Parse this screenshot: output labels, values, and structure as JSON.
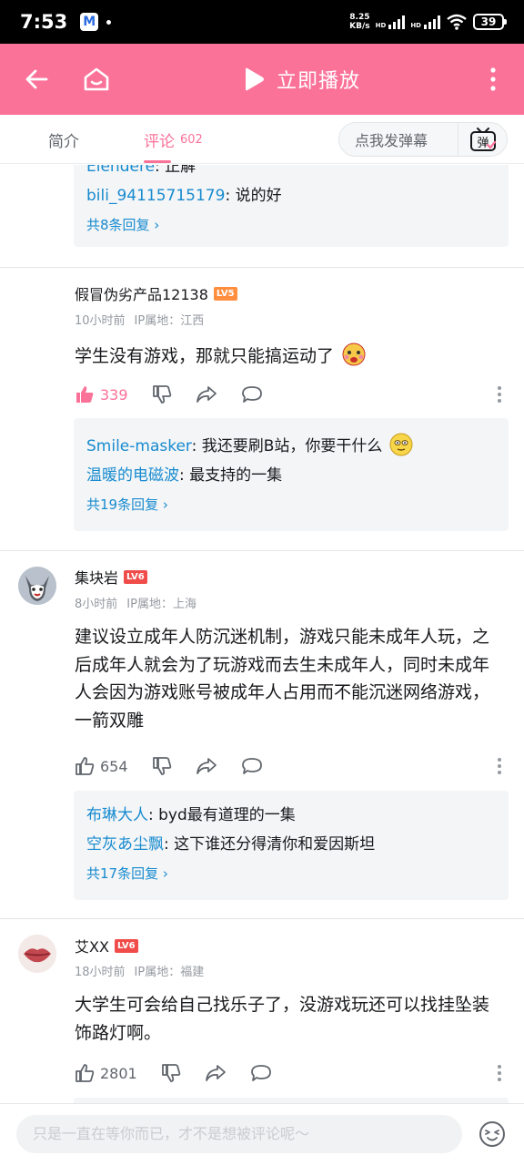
{
  "status_bar": {
    "time": "7:53",
    "app_badge": "M",
    "net_speed_value": "8.25",
    "net_speed_unit": "KB/s",
    "hd_label": "HD",
    "battery": "39"
  },
  "header": {
    "play_label": "立即播放"
  },
  "tabs": {
    "intro_label": "简介",
    "comments_label": "评论",
    "comments_count": "602",
    "danmaku_placeholder": "点我发弹幕",
    "danmaku_button": "弹"
  },
  "top_reply_box": {
    "lines": [
      {
        "user": "Elendere",
        "text": ": 正解"
      },
      {
        "user": "bili_94115715179",
        "text": ": 说的好"
      }
    ],
    "more": "共8条回复 ›"
  },
  "comments": [
    {
      "username": "假冒伪劣产品12138",
      "level": "LV5",
      "time": "10小时前",
      "ip": "IP属地：江西",
      "content": "学生没有游戏，那就只能搞运动了",
      "likes": "339",
      "replies": [
        {
          "user": "Smile-masker",
          "text": ": 我还要刷B站，你要干什么"
        },
        {
          "user": "温暖的电磁波",
          "text": ": 最支持的一集"
        }
      ],
      "more": "共19条回复 ›"
    },
    {
      "username": "集块岩",
      "level": "LV6",
      "time": "8小时前",
      "ip": "IP属地：上海",
      "content": "建议设立成年人防沉迷机制，游戏只能未成年人玩，之后成年人就会为了玩游戏而去生未成年人，同时未成年人会因为游戏账号被成年人占用而不能沉迷网络游戏，一箭双雕",
      "likes": "654",
      "replies": [
        {
          "user": "布琳大人",
          "text": ": byd最有道理的一集"
        },
        {
          "user": "空灰あ尘飘",
          "text": ": 这下谁还分得清你和爱因斯坦"
        }
      ],
      "more": "共17条回复 ›"
    },
    {
      "username": "艾XX",
      "level": "LV6",
      "time": "18小时前",
      "ip": "IP属地：福建",
      "content": "大学生可会给自己找乐子了，没游戏玩还可以找挂坠装饰路灯啊。",
      "likes": "2801"
    }
  ],
  "bottom_bar": {
    "input_placeholder": "只是一直在等你而已，才不是想被评论呢～"
  },
  "colors": {
    "brand_pink": "#fb7299",
    "reply_user_blue": "#178bcf",
    "lv5_orange": "#ff8f3f",
    "lv6_red": "#f04c49"
  }
}
